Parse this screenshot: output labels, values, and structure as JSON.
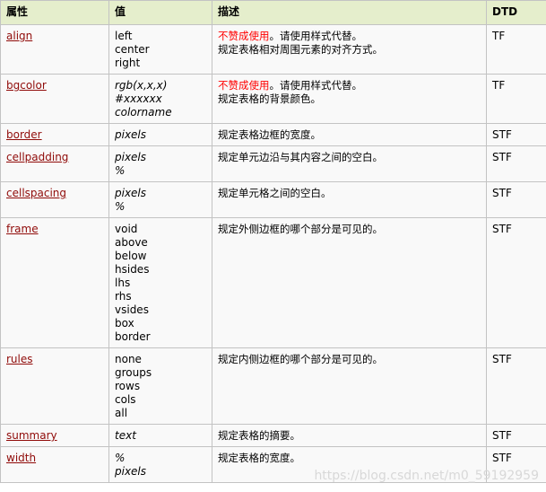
{
  "headers": {
    "attr": "属性",
    "value": "值",
    "desc": "描述",
    "dtd": "DTD"
  },
  "rows": [
    {
      "attr": "align",
      "values": [
        "left",
        "center",
        "right"
      ],
      "italic": false,
      "deprecated": "不赞成使用",
      "deprecated_tail": "。请使用样式代替。",
      "desc": [
        "规定表格相对周围元素的对齐方式。"
      ],
      "dtd": "TF"
    },
    {
      "attr": "bgcolor",
      "values": [
        "rgb(x,x,x)",
        "#xxxxxx",
        "colorname"
      ],
      "italic": true,
      "deprecated": "不赞成使用",
      "deprecated_tail": "。请使用样式代替。",
      "desc": [
        "规定表格的背景颜色。"
      ],
      "dtd": "TF"
    },
    {
      "attr": "border",
      "values": [
        "pixels"
      ],
      "italic": true,
      "desc": [
        "规定表格边框的宽度。"
      ],
      "dtd": "STF"
    },
    {
      "attr": "cellpadding",
      "values": [
        "pixels",
        "%"
      ],
      "italic": true,
      "desc": [
        "规定单元边沿与其内容之间的空白。"
      ],
      "dtd": "STF"
    },
    {
      "attr": "cellspacing",
      "values": [
        "pixels",
        "%"
      ],
      "italic": true,
      "desc": [
        "规定单元格之间的空白。"
      ],
      "dtd": "STF"
    },
    {
      "attr": "frame",
      "values": [
        "void",
        "above",
        "below",
        "hsides",
        "lhs",
        "rhs",
        "vsides",
        "box",
        "border"
      ],
      "italic": false,
      "desc": [
        "规定外侧边框的哪个部分是可见的。"
      ],
      "dtd": "STF"
    },
    {
      "attr": "rules",
      "values": [
        "none",
        "groups",
        "rows",
        "cols",
        "all"
      ],
      "italic": false,
      "desc": [
        "规定内侧边框的哪个部分是可见的。"
      ],
      "dtd": "STF"
    },
    {
      "attr": "summary",
      "values": [
        "text"
      ],
      "italic": true,
      "desc": [
        "规定表格的摘要。"
      ],
      "dtd": "STF"
    },
    {
      "attr": "width",
      "values": [
        "%",
        "pixels"
      ],
      "italic": true,
      "desc": [
        "规定表格的宽度。"
      ],
      "dtd": "STF"
    }
  ],
  "watermark": "https://blog.csdn.net/m0_59192959"
}
